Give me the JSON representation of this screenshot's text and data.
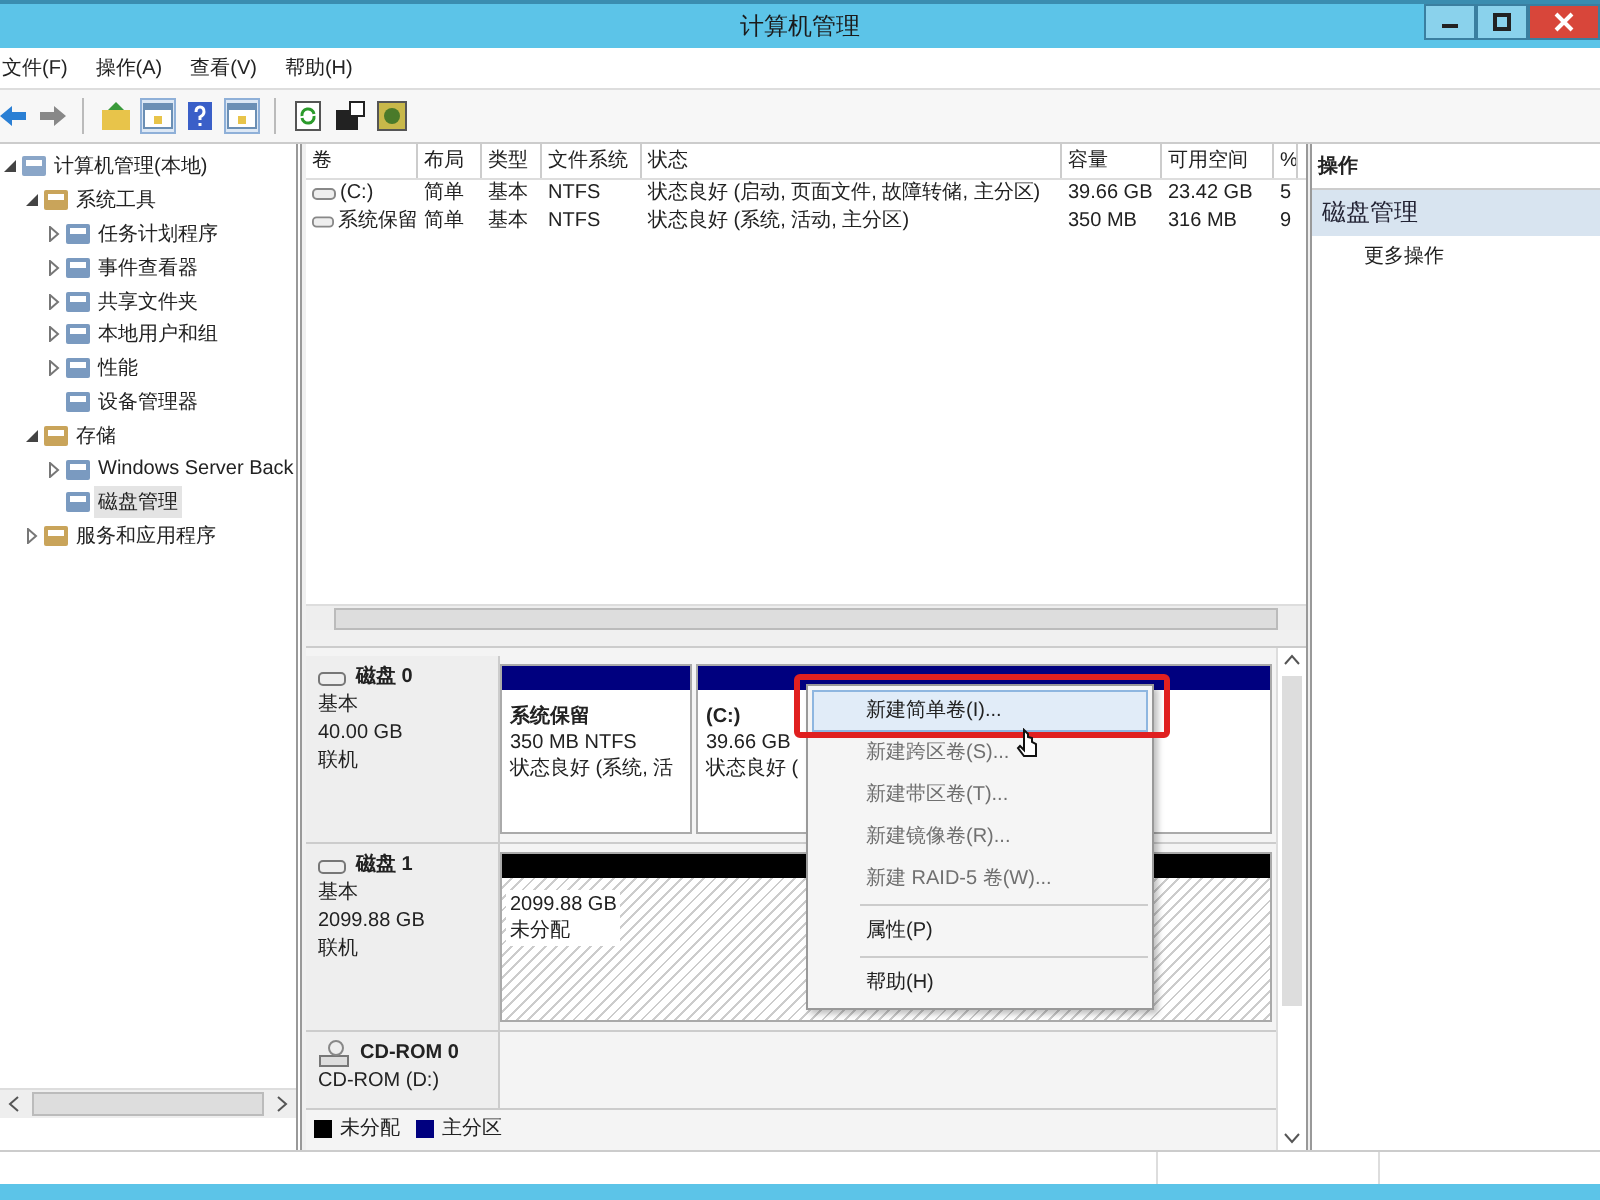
{
  "window": {
    "title": "计算机管理"
  },
  "menu": [
    "文件(F)",
    "操作(A)",
    "查看(V)",
    "帮助(H)"
  ],
  "tree": [
    {
      "label": "计算机管理(本地)",
      "expanded": true,
      "selected": false,
      "children": [
        {
          "label": "系统工具",
          "expanded": true,
          "selected": false,
          "children": [
            {
              "label": "任务计划程序",
              "expanded": false,
              "selected": false
            },
            {
              "label": "事件查看器",
              "expanded": false,
              "selected": false
            },
            {
              "label": "共享文件夹",
              "expanded": false,
              "selected": false
            },
            {
              "label": "本地用户和组",
              "expanded": false,
              "selected": false
            },
            {
              "label": "性能",
              "expanded": false,
              "selected": false
            },
            {
              "label": "设备管理器",
              "selected": false
            }
          ]
        },
        {
          "label": "存储",
          "expanded": true,
          "selected": false,
          "children": [
            {
              "label": "Windows Server Back",
              "expanded": false,
              "selected": false
            },
            {
              "label": "磁盘管理",
              "selected": true
            }
          ]
        },
        {
          "label": "服务和应用程序",
          "expanded": false,
          "selected": false
        }
      ]
    }
  ],
  "volumes": {
    "columns": [
      "卷",
      "布局",
      "类型",
      "文件系统",
      "状态",
      "容量",
      "可用空间",
      "%"
    ],
    "rows": [
      [
        "(C:)",
        "简单",
        "基本",
        "NTFS",
        "状态良好 (启动, 页面文件, 故障转储, 主分区)",
        "39.66 GB",
        "23.42 GB",
        "5"
      ],
      [
        "系统保留",
        "简单",
        "基本",
        "NTFS",
        "状态良好 (系统, 活动, 主分区)",
        "350 MB",
        "316 MB",
        "9"
      ]
    ]
  },
  "disks": [
    {
      "kind": "disk",
      "name": "磁盘 0",
      "lines": [
        "基本",
        "40.00 GB",
        "联机"
      ],
      "partitions": [
        {
          "color": "#00007f",
          "hatched": false,
          "title": "系统保留",
          "lines": [
            "350 MB NTFS",
            "状态良好 (系统, 活"
          ]
        },
        {
          "color": "#00007f",
          "hatched": false,
          "title": "(C:)",
          "lines": [
            "39.66 GB",
            "状态良好 ("
          ]
        }
      ]
    },
    {
      "kind": "disk",
      "name": "磁盘 1",
      "lines": [
        "基本",
        "2099.88 GB",
        "联机"
      ],
      "partitions": [
        {
          "color": "#000000",
          "hatched": true,
          "lines": [
            "2099.88 GB",
            "未分配"
          ]
        }
      ]
    },
    {
      "kind": "cdrom",
      "name": "CD-ROM 0",
      "lines": [
        "CD-ROM (D:)"
      ]
    }
  ],
  "legend": [
    {
      "label": "未分配",
      "color": "#000000"
    },
    {
      "label": "主分区",
      "color": "#00007f"
    }
  ],
  "actions": {
    "header": "操作",
    "section": "磁盘管理",
    "items": [
      "更多操作"
    ]
  },
  "context_menu": [
    {
      "label": "新建简单卷(I)...",
      "disabled": false,
      "selected": true
    },
    {
      "label": "新建跨区卷(S)...",
      "disabled": true,
      "selected": false
    },
    {
      "label": "新建带区卷(T)...",
      "disabled": true,
      "selected": false
    },
    {
      "label": "新建镜像卷(R)...",
      "disabled": true,
      "selected": false
    },
    {
      "label": "新建 RAID-5 卷(W)...",
      "disabled": true,
      "selected": false,
      "separator_after": true
    },
    {
      "label": "属性(P)",
      "disabled": false,
      "selected": false,
      "separator_after": true
    },
    {
      "label": "帮助(H)",
      "disabled": false,
      "selected": false
    }
  ]
}
